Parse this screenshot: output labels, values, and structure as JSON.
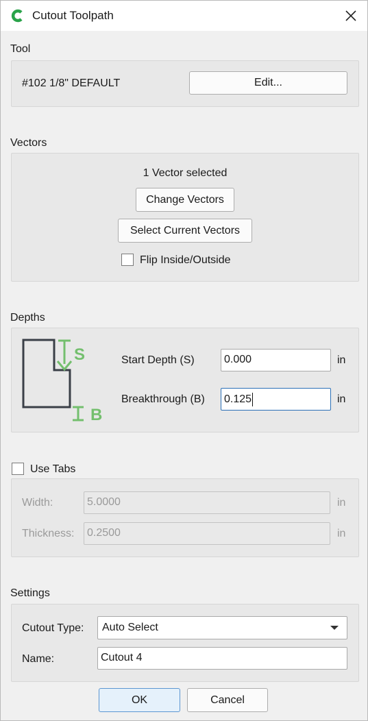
{
  "window": {
    "title": "Cutout Toolpath"
  },
  "icons": {
    "app": "app-logo-icon",
    "close": "close-icon"
  },
  "tool": {
    "section_label": "Tool",
    "name": "#102 1/8\" DEFAULT",
    "edit_label": "Edit..."
  },
  "vectors": {
    "section_label": "Vectors",
    "status": "1 Vector selected",
    "change_label": "Change Vectors",
    "select_current_label": "Select Current Vectors",
    "flip_label": "Flip Inside/Outside",
    "flip_checked": false
  },
  "depths": {
    "section_label": "Depths",
    "diagram": {
      "start_letter": "S",
      "break_letter": "B",
      "accent": "#74bf6e"
    },
    "start_label": "Start Depth (S)",
    "start_value": "0.000",
    "start_unit": "in",
    "break_label": "Breakthrough (B)",
    "break_value": "0.125",
    "break_unit": "in"
  },
  "tabs": {
    "use_tabs_label": "Use Tabs",
    "use_tabs_checked": false,
    "width_label": "Width:",
    "width_value": "5.0000",
    "width_unit": "in",
    "thickness_label": "Thickness:",
    "thickness_value": "0.2500",
    "thickness_unit": "in"
  },
  "settings": {
    "section_label": "Settings",
    "cutout_type_label": "Cutout Type:",
    "cutout_type_value": "Auto Select",
    "name_label": "Name:",
    "name_value": "Cutout 4"
  },
  "footer": {
    "ok_label": "OK",
    "cancel_label": "Cancel"
  }
}
